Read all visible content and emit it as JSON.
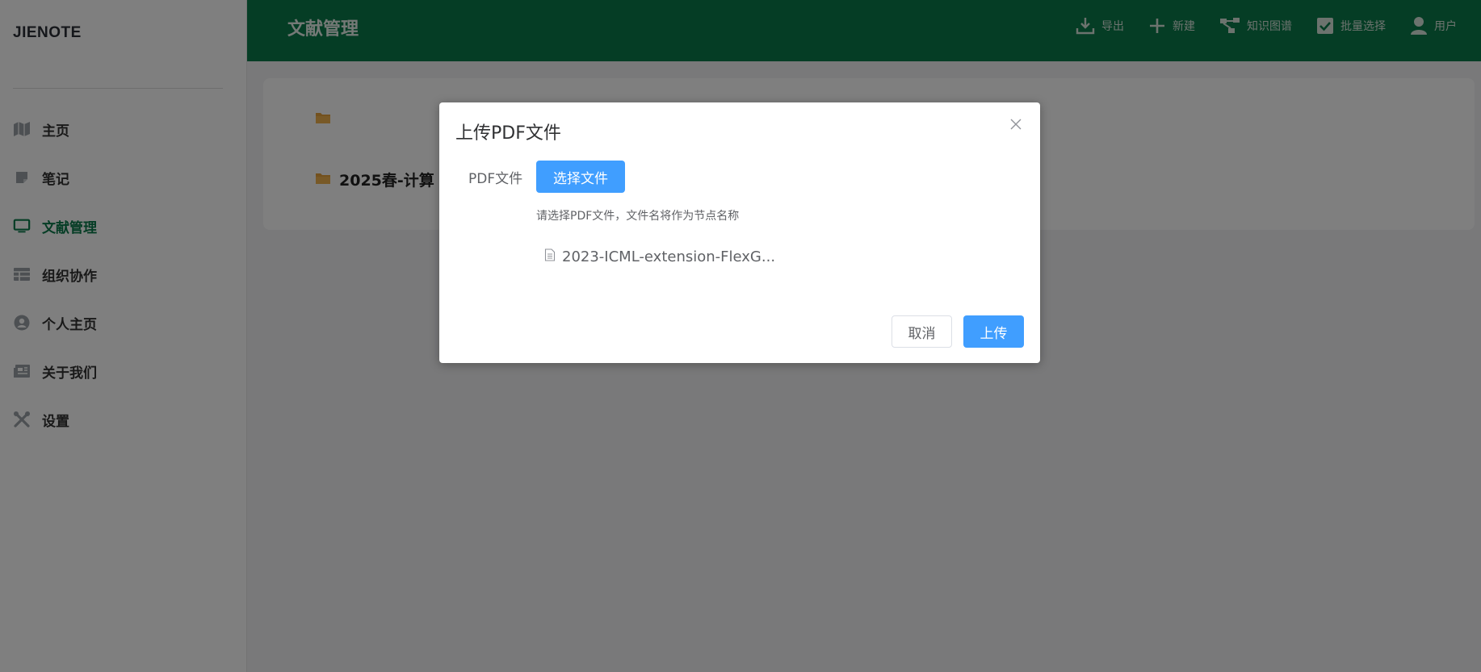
{
  "sidebar": {
    "logo": "JIENOTE",
    "items": [
      {
        "label": "主页",
        "icon": "map-icon"
      },
      {
        "label": "笔记",
        "icon": "note-icon"
      },
      {
        "label": "文献管理",
        "icon": "monitor-icon",
        "active": true
      },
      {
        "label": "组织协作",
        "icon": "table-icon"
      },
      {
        "label": "个人主页",
        "icon": "user-circle-icon"
      },
      {
        "label": "关于我们",
        "icon": "newspaper-icon"
      },
      {
        "label": "设置",
        "icon": "tools-icon"
      }
    ]
  },
  "header": {
    "title": "文献管理",
    "toolbar": {
      "export": "导出",
      "new": "新建",
      "knowledge_graph": "知识图谱",
      "batch_select": "批量选择",
      "user": "用户"
    }
  },
  "main": {
    "folders": [
      {
        "name": ""
      },
      {
        "name": "2025春-计算"
      }
    ]
  },
  "dialog": {
    "title": "上传PDF文件",
    "field_label": "PDF文件",
    "choose_button": "选择文件",
    "hint": "请选择PDF文件，文件名将作为节点名称",
    "file_name": "2023-ICML-extension-FlexG...",
    "cancel_button": "取消",
    "upload_button": "上传"
  },
  "colors": {
    "brand_green": "#0b7a4b",
    "primary_blue": "#409eff",
    "folder_yellow": "#e6a23c"
  }
}
